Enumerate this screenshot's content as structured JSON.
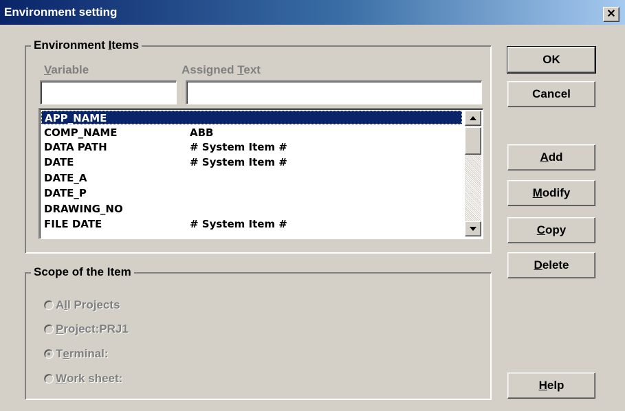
{
  "window": {
    "title": "Environment setting",
    "close_symbol": "✕"
  },
  "items_group": {
    "legend_pre": "Environment ",
    "legend_ul": "I",
    "legend_post": "tems",
    "variable_label_ul": "V",
    "variable_label_post": "ariable",
    "assigned_label_pre": "Assigned ",
    "assigned_label_ul": "T",
    "assigned_label_post": "ext",
    "variable_value": "",
    "assigned_value": "",
    "rows": [
      {
        "variable": "APP_NAME",
        "text": "",
        "selected": true
      },
      {
        "variable": "COMP_NAME",
        "text": "ABB"
      },
      {
        "variable": "DATA PATH",
        "text": "# System Item #"
      },
      {
        "variable": "DATE",
        "text": "# System Item #"
      },
      {
        "variable": "DATE_A",
        "text": ""
      },
      {
        "variable": "DATE_P",
        "text": ""
      },
      {
        "variable": "DRAWING_NO",
        "text": ""
      },
      {
        "variable": "FILE DATE",
        "text": "# System Item #"
      }
    ]
  },
  "scope_group": {
    "legend": "Scope of the Item",
    "options": [
      {
        "pre": "A",
        "ul": "l",
        "post": "l Projects",
        "checked": false
      },
      {
        "pre": "",
        "ul": "P",
        "post": "roject:PRJ1",
        "checked": false
      },
      {
        "pre": "T",
        "ul": "e",
        "post": "rminal:",
        "checked": true
      },
      {
        "pre": "",
        "ul": "W",
        "post": "ork sheet:",
        "checked": false
      }
    ]
  },
  "buttons": {
    "ok": "OK",
    "cancel": "Cancel",
    "add_ul": "A",
    "add_post": "dd",
    "modify_ul": "M",
    "modify_post": "odify",
    "copy_ul": "C",
    "copy_post": "opy",
    "delete_ul": "D",
    "delete_post": "elete",
    "help_ul": "H",
    "help_post": "elp"
  }
}
